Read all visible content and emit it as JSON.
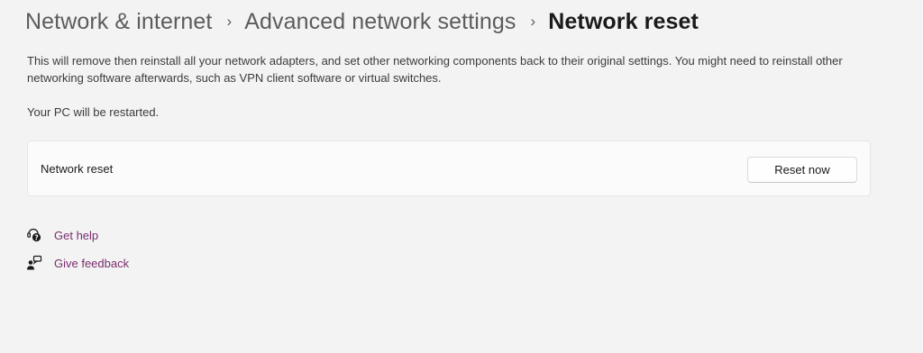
{
  "breadcrumb": {
    "items": [
      "Network & internet",
      "Advanced network settings"
    ],
    "current": "Network reset",
    "separator": "›"
  },
  "description": "This will remove then reinstall all your network adapters, and set other networking components back to their original settings. You might need to reinstall other networking software afterwards, such as VPN client software or virtual switches.",
  "restart_note": "Your PC will be restarted.",
  "reset_card": {
    "label": "Network reset",
    "button_label": "Reset now"
  },
  "links": {
    "get_help": "Get help",
    "give_feedback": "Give feedback"
  },
  "icons": {
    "get_help": "help-chat-icon",
    "give_feedback": "feedback-person-icon"
  },
  "colors": {
    "link": "#7a2d6e",
    "background": "#f3f3f3",
    "card": "#fbfbfb"
  }
}
